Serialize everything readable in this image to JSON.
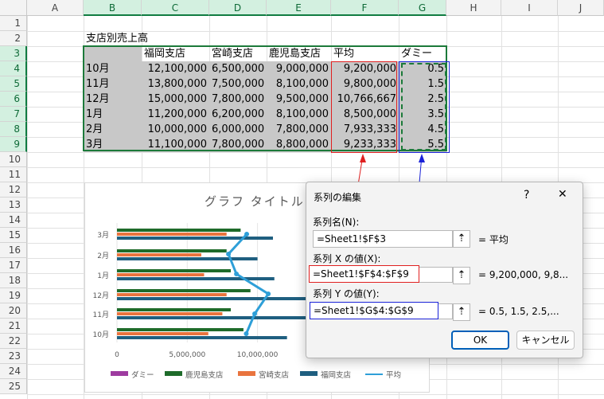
{
  "columns": [
    "A",
    "B",
    "C",
    "D",
    "E",
    "F",
    "G",
    "H",
    "I",
    "J"
  ],
  "rows": [
    "1",
    "2",
    "3",
    "4",
    "5",
    "6",
    "7",
    "8",
    "9",
    "10",
    "11",
    "12",
    "13",
    "14",
    "15",
    "16",
    "17",
    "18",
    "19",
    "20",
    "21",
    "22",
    "23",
    "24",
    "25"
  ],
  "table": {
    "title": "支店別売上高",
    "headers": [
      "",
      "福岡支店",
      "宮崎支店",
      "鹿児島支店",
      "平均",
      "ダミー"
    ],
    "rows": [
      [
        "10月",
        "12,100,000",
        "6,500,000",
        "9,000,000",
        "9,200,000",
        "0.5"
      ],
      [
        "11月",
        "13,800,000",
        "7,500,000",
        "8,100,000",
        "9,800,000",
        "1.5"
      ],
      [
        "12月",
        "15,000,000",
        "7,800,000",
        "9,500,000",
        "10,766,667",
        "2.5"
      ],
      [
        "1月",
        "11,200,000",
        "6,200,000",
        "8,100,000",
        "8,500,000",
        "3.5"
      ],
      [
        "2月",
        "10,000,000",
        "6,000,000",
        "7,800,000",
        "7,933,333",
        "4.5"
      ],
      [
        "3月",
        "11,100,000",
        "7,800,000",
        "8,800,000",
        "9,233,333",
        "5.5"
      ]
    ]
  },
  "chart": {
    "title": "グラフ タイトル",
    "y_ticks": [
      "3月",
      "2月",
      "1月",
      "12月",
      "11月",
      "10月"
    ],
    "x_ticks": [
      "0",
      "5,000,000",
      "10,000,000"
    ],
    "legend": [
      "ダミー",
      "鹿児島支店",
      "宮崎支店",
      "福岡支店",
      "平均"
    ],
    "colors": {
      "dummy": "#9e3ba0",
      "kagoshima": "#1e6b2a",
      "miyazaki": "#e9743e",
      "fukuoka": "#1f5f80",
      "avg": "#2e9fd8"
    }
  },
  "chart_data": {
    "type": "bar",
    "orientation": "horizontal",
    "categories": [
      "3月",
      "2月",
      "1月",
      "12月",
      "11月",
      "10月"
    ],
    "series": [
      {
        "name": "鹿児島支店",
        "values": [
          8800000,
          7800000,
          8100000,
          9500000,
          8100000,
          9000000
        ]
      },
      {
        "name": "宮崎支店",
        "values": [
          7800000,
          6000000,
          6200000,
          7800000,
          7500000,
          6500000
        ]
      },
      {
        "name": "福岡支店",
        "values": [
          11100000,
          10000000,
          11200000,
          15000000,
          13800000,
          12100000
        ]
      },
      {
        "name": "平均",
        "type": "line",
        "x": [
          9233333,
          7933333,
          8500000,
          10766667,
          9800000,
          9200000
        ],
        "y": [
          5.5,
          4.5,
          3.5,
          2.5,
          1.5,
          0.5
        ]
      }
    ],
    "xlim": [
      0,
      11100000
    ]
  },
  "dialog": {
    "title": "系列の編集",
    "help": "?",
    "close": "✕",
    "name_label": "系列名(N):",
    "name_value": "=Sheet1!$F$3",
    "name_result": "= 平均",
    "x_label": "系列 X の値(X):",
    "x_value": "=Sheet1!$F$4:$F$9",
    "x_result": "= 9,200,000, 9,8...",
    "y_label": "系列 Y の値(Y):",
    "y_value": "=Sheet1!$G$4:$G$9",
    "y_result": "= 0.5, 1.5, 2.5,...",
    "ok": "OK",
    "cancel": "キャンセル",
    "picker_icon": "collapse-arrow-icon"
  }
}
